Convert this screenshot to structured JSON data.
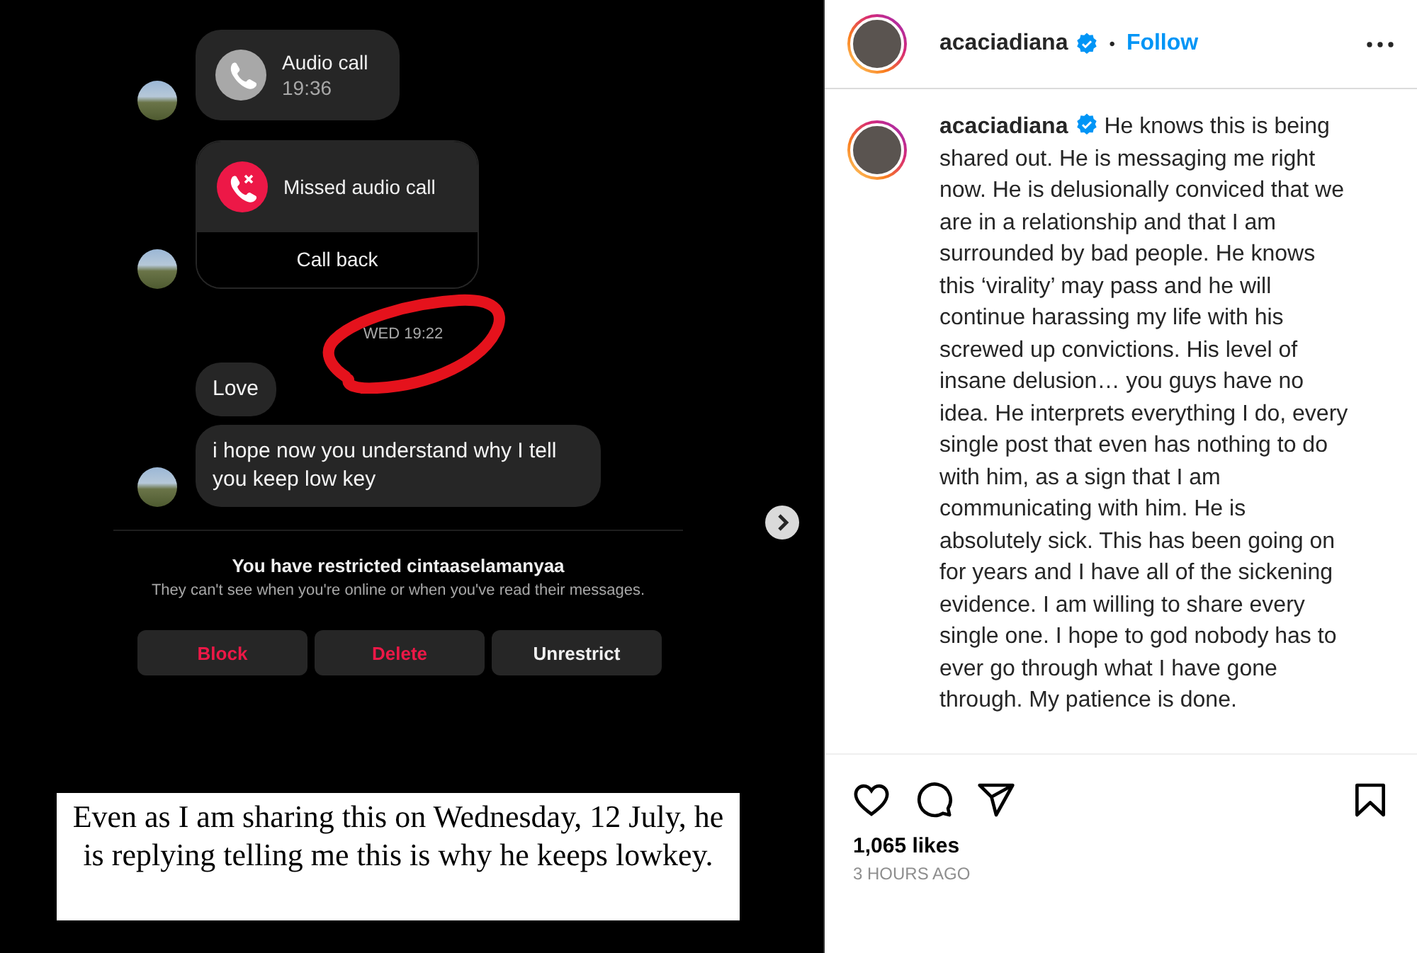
{
  "post_image": {
    "chat": {
      "messages": [
        {
          "kind": "call",
          "title": "Audio call",
          "time": "19:36",
          "avatar": true
        },
        {
          "kind": "missed_call",
          "title": "Missed audio call",
          "action": "Call back",
          "avatar": true
        },
        {
          "kind": "timestamp",
          "text": "WED 19:22",
          "circled": true
        },
        {
          "kind": "text",
          "text": "Love",
          "avatar": false
        },
        {
          "kind": "text",
          "text": "i hope now you understand why I tell you keep low key",
          "avatar": true
        }
      ],
      "restricted_notice": {
        "title": "You have restricted cintaaselamanyaa",
        "body": "They can't see when you're online or when you've read their messages."
      },
      "buttons": [
        {
          "label": "Block",
          "kind": "danger"
        },
        {
          "label": "Delete",
          "kind": "danger"
        },
        {
          "label": "Unrestrict",
          "kind": "normal"
        }
      ]
    },
    "caption_overlay": "Even as I am sharing this on Wednesday, 12 July, he is replying telling me this is why he keeps lowkey."
  },
  "post": {
    "author": {
      "username": "acaciadiana",
      "verified": true
    },
    "separator": "•",
    "follow": "Follow",
    "caption": {
      "username": "acaciadiana",
      "verified": true,
      "text": "He knows this is being shared out. He is messaging me right now. He is delusionally conviced that we are in a relationship and that I am surrounded by bad people. He knows this ‘virality’ may pass and he will continue harassing my life with his screwed up convictions. His level of insane delusion… you guys have no idea. He interprets everything I do, every single post that even has nothing to do with him, as a sign that I am communicating with him. He is absolutely sick. This has been going on for years and I have all of the sickening evidence. I am willing to share every single one. I hope to god nobody has to ever go through what I have gone through. My patience is done."
    },
    "likes": "1,065 likes",
    "time": "3 HOURS AGO"
  }
}
